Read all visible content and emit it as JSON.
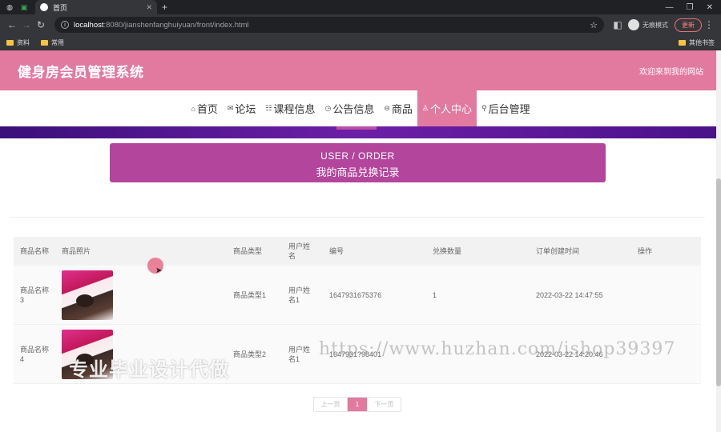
{
  "browser": {
    "tab_title": "首页",
    "url_host": "localhost",
    "url_path": ":8080/jianshenfanghuiyuan/front/index.html",
    "incognito_label": "无痕模式",
    "update_label": "更新",
    "bookmarks": [
      "资料",
      "常用"
    ],
    "other_bookmarks": "其他书签"
  },
  "site": {
    "title": "健身房会员管理系统",
    "welcome": "欢迎来到我的网站"
  },
  "nav": [
    {
      "icon": "⌂",
      "label": "首页"
    },
    {
      "icon": "✉",
      "label": "论坛"
    },
    {
      "icon": "☷",
      "label": "课程信息"
    },
    {
      "icon": "◷",
      "label": "公告信息"
    },
    {
      "icon": "⊖",
      "label": "商品"
    },
    {
      "icon": "♙",
      "label": "个人中心"
    },
    {
      "icon": "⚲",
      "label": "后台管理"
    }
  ],
  "nav_active_index": 5,
  "breadcrumb": {
    "en": "USER / ORDER",
    "cn": "我的商品兑换记录"
  },
  "table": {
    "headers": [
      "商品名称",
      "商品照片",
      "商品类型",
      "用户姓名",
      "编号",
      "兑换数量",
      "订单创建时间",
      "操作"
    ],
    "rows": [
      [
        "商品名称3",
        "",
        "商品类型1",
        "用户姓名1",
        "1647931675376",
        "1",
        "2022-03-22 14:47:55",
        ""
      ],
      [
        "商品名称4",
        "",
        "商品类型2",
        "用户姓名1",
        "1647931?98401",
        "",
        "2022-03-22 14:20:46",
        ""
      ]
    ]
  },
  "pager": {
    "prev": "上一页",
    "current": "1",
    "next": "下一页"
  },
  "watermarks": {
    "url": "https://www.huzhan.com/ishop39397",
    "text": "专业毕业设计代做"
  }
}
